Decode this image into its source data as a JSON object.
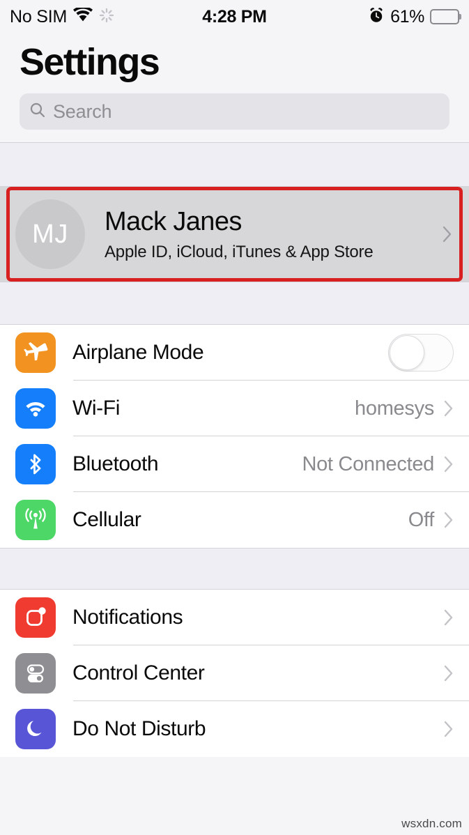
{
  "status_bar": {
    "carrier": "No SIM",
    "wifi_icon": "wifi-icon",
    "activity_icon": "activity-spinner-icon",
    "time": "4:28 PM",
    "alarm_icon": "alarm-clock-icon",
    "battery_percent": "61%",
    "battery_icon": "battery-icon"
  },
  "header": {
    "title": "Settings"
  },
  "search": {
    "icon": "search-icon",
    "placeholder": "Search",
    "value": ""
  },
  "apple_id": {
    "initials": "MJ",
    "name": "Mack Janes",
    "subtitle": "Apple ID, iCloud, iTunes & App Store",
    "chevron_icon": "chevron-right-icon",
    "highlight_color": "#D92020",
    "highlighted": true
  },
  "groups": [
    {
      "id": "connectivity",
      "rows": [
        {
          "id": "airplane-mode",
          "label": "Airplane Mode",
          "icon": "airplane-icon",
          "icon_color": "#F29220",
          "accessory": "toggle",
          "toggle_on": false,
          "value": ""
        },
        {
          "id": "wifi",
          "label": "Wi-Fi",
          "icon": "wifi-icon",
          "icon_color": "#147EFB",
          "accessory": "chevron",
          "value": "homesys"
        },
        {
          "id": "bluetooth",
          "label": "Bluetooth",
          "icon": "bluetooth-icon",
          "icon_color": "#147EFB",
          "accessory": "chevron",
          "value": "Not Connected"
        },
        {
          "id": "cellular",
          "label": "Cellular",
          "icon": "cellular-antenna-icon",
          "icon_color": "#4CD766",
          "accessory": "chevron",
          "value": "Off"
        }
      ]
    },
    {
      "id": "system",
      "rows": [
        {
          "id": "notifications",
          "label": "Notifications",
          "icon": "notifications-icon",
          "icon_color": "#EF3B30",
          "accessory": "chevron",
          "value": ""
        },
        {
          "id": "control-center",
          "label": "Control Center",
          "icon": "control-center-icon",
          "icon_color": "#8E8E93",
          "accessory": "chevron",
          "value": ""
        },
        {
          "id": "do-not-disturb",
          "label": "Do Not Disturb",
          "icon": "moon-icon",
          "icon_color": "#5856D6",
          "accessory": "chevron",
          "value": ""
        }
      ]
    }
  ],
  "watermark": {
    "text": "wsxdn.com"
  }
}
